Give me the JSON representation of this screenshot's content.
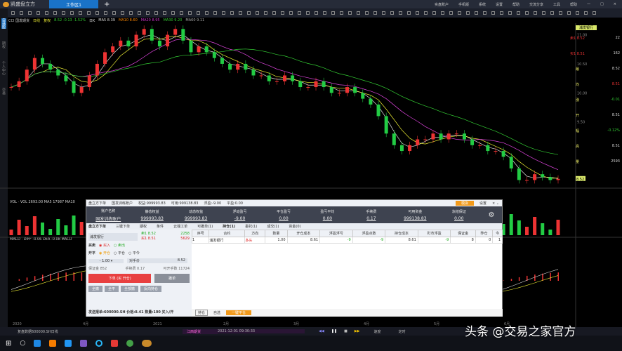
{
  "app": {
    "title": "凯盛盘立方",
    "tab": "工作区1"
  },
  "menus": [
    "实盘账户",
    "手机版",
    "系统",
    "设置",
    "帮助",
    "交流分享",
    "工具",
    "帮助"
  ],
  "sidebar": [
    "自选股",
    "期权",
    "个人中心",
    "交易"
  ],
  "infoline": [
    "CCI 国发期货",
    "日线",
    "复权",
    "8.52 -0.13 -1.52%",
    "日K",
    "MA5 8.39",
    "MA10 8.60",
    "MA20 8.95",
    "MA30 9.20",
    "MA60 9.11"
  ],
  "price_axis": [
    "11.00",
    "10.50",
    "10.00",
    "9.50",
    "8.52"
  ],
  "quote": {
    "title": "浦发银行",
    "rows": [
      [
        "卖1 8.52",
        "22"
      ],
      [
        "买1 8.51",
        "162"
      ],
      [
        "最",
        "8.52"
      ],
      [
        "均",
        "8.51"
      ],
      [
        "涨",
        "-0.01"
      ],
      [
        "开",
        "8.51"
      ],
      [
        "幅",
        "-0.12%"
      ],
      [
        "高",
        "8.51"
      ],
      [
        "量",
        "2593"
      ]
    ]
  },
  "volume": {
    "label": "VOL · VOL 2693.00 MA5 17987 MA10"
  },
  "macd": {
    "label": "MACD · DIFF -0.06 DEA -0.08 MACD"
  },
  "dates": [
    "2020",
    "4月",
    "2021",
    "2月",
    "3月",
    "4月",
    "5月",
    "6月"
  ],
  "chart_data": {
    "type": "candlestick",
    "closes": [
      10.1,
      10.2,
      10.4,
      10.6,
      10.5,
      10.4,
      10.3,
      10.2,
      10.0,
      10.1,
      10.3,
      10.5,
      10.7,
      10.8,
      10.9,
      10.8,
      11.0,
      11.1,
      10.9,
      10.8,
      11.0,
      11.1,
      10.9,
      10.7,
      10.8,
      10.7,
      10.6,
      10.5,
      10.4,
      10.5,
      10.4,
      10.3,
      10.3,
      10.2,
      10.2,
      10.3,
      10.2,
      10.1,
      10.1,
      10.2,
      10.1,
      10.0,
      10.0,
      10.1,
      10.0,
      9.9,
      9.8,
      9.6,
      9.3,
      9.1,
      9.0,
      9.1,
      9.2,
      9.2,
      9.3,
      9.2,
      9.3,
      9.3,
      9.2,
      9.1,
      9.1,
      9.0,
      9.0,
      8.9,
      8.7,
      8.5,
      8.5,
      8.6,
      8.55,
      8.5,
      8.52
    ],
    "ylim": [
      8.3,
      11.2
    ]
  },
  "dialog": {
    "title": [
      "盘立方下单",
      "国发训练账户",
      "权益:999993.83",
      "可用:999138.83",
      "浮盈:-9.00",
      "平盈:0.00"
    ],
    "sim_badge": "模拟",
    "settings": "设置",
    "summary": [
      [
        "账户名称",
        "国发训练账户"
      ],
      [
        "静态权益",
        "999993.83"
      ],
      [
        "动态权益",
        "999993.83"
      ],
      [
        "浮动盈亏",
        "-9.00"
      ],
      [
        "平仓盈亏",
        "0.00"
      ],
      [
        "盈亏平均",
        "0.00"
      ],
      [
        "手续费",
        "0.17"
      ],
      [
        "可用资金",
        "999138.83"
      ],
      [
        "冻结保证",
        "0.00"
      ]
    ],
    "tabs": [
      "盘立方下单",
      "三键下单",
      "期权",
      "条件",
      "云端工单",
      "可撤单(1)",
      "持仓(1)",
      "委托(1)",
      "成交(1)",
      "资金(0)"
    ],
    "symbol": "浦发银行",
    "ask": "卖1 8.52",
    "ask_vol": "2258",
    "bid": "买1 8.51",
    "bid_vol": "5629",
    "side_label": "买卖",
    "buy": "买入",
    "sell": "卖出",
    "oc_label": "开平",
    "open": "开仓",
    "close_t": "平仓",
    "close_y": "平今",
    "qty": "1.00",
    "price_type": "对手价",
    "price": "8.52",
    "margin": "保证金 852",
    "fee": "手续费 0.17",
    "max_open": "可开手数 11724",
    "submit": "下单 (买 开仓)",
    "cancel": "撤单",
    "small_buttons": [
      "全撤",
      "全平",
      "全部撤",
      "反向持仓"
    ],
    "status": "发送报单:600000.SH 价格:8.41 数量:100 买入/开",
    "columns": [
      "序号",
      "合约",
      "方向",
      "数量",
      "开仓成本",
      "浮盈浮亏",
      "浮盈点数",
      "持仓成本",
      "盯市浮盈",
      "保证金",
      "昨仓",
      "今"
    ],
    "rows": [
      [
        "1",
        "浦发银行",
        "多头",
        "1.00",
        "8.61",
        "-9",
        "-9",
        "8.61",
        "-9",
        "8",
        "0",
        "1"
      ]
    ],
    "foot_tabs": [
      "持仓",
      "自选",
      "一键平仓"
    ]
  },
  "replay": {
    "file": "复盘数据600000.SH日线",
    "mode": "江西期货",
    "time": "2021-12-01  09:30:33",
    "speed": "速度",
    "timer": "定时"
  },
  "watermark": "头条 @交易之家官方"
}
